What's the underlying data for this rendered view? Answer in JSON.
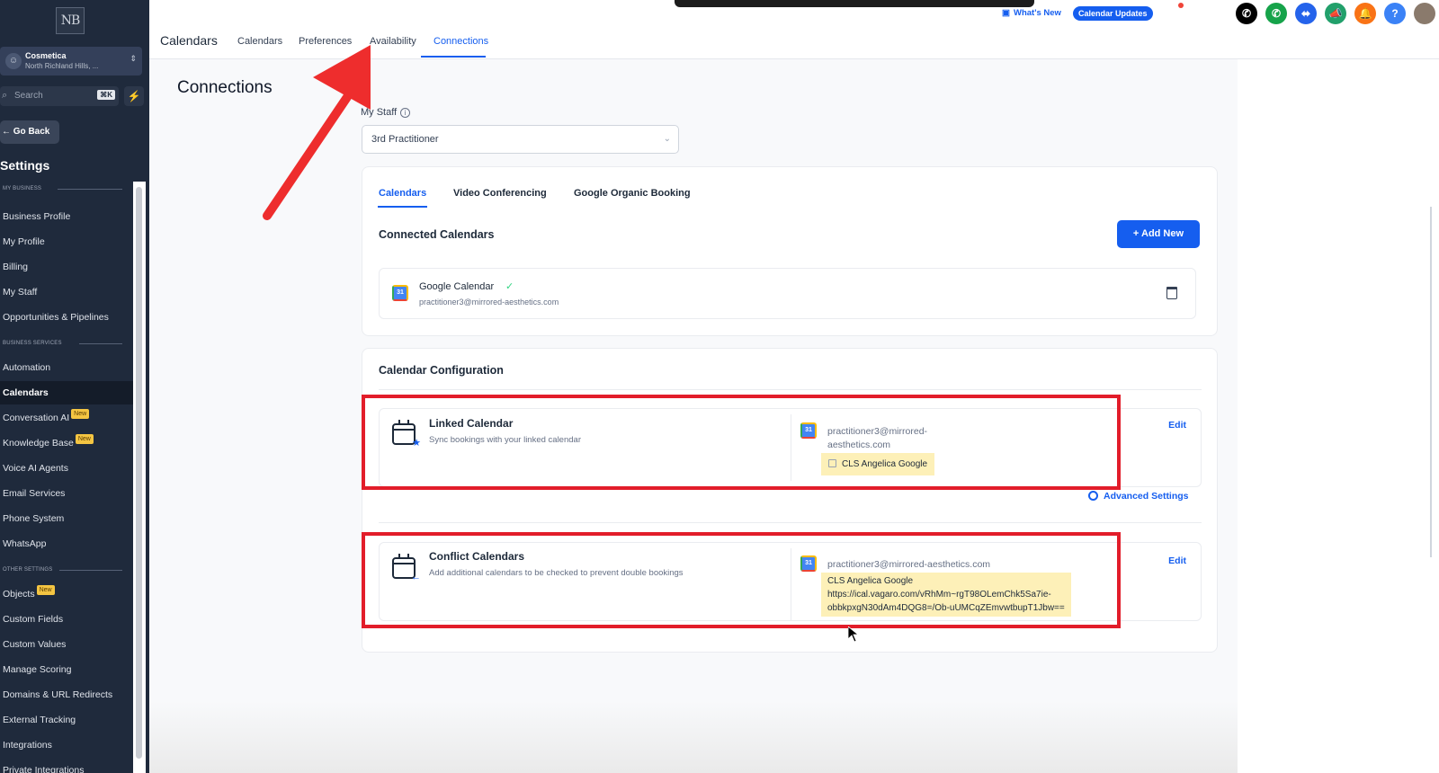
{
  "sidebar": {
    "logo": "NB",
    "account": {
      "name": "Cosmetica",
      "location": "North Richland Hills, ...",
      "avatar_glyph": "☺"
    },
    "search": {
      "placeholder": "Search",
      "shortcut": "⌘K"
    },
    "go_back": "← Go Back",
    "settings_title": "Settings",
    "sections": [
      {
        "label": "MY BUSINESS"
      },
      {
        "label": "BUSINESS SERVICES"
      },
      {
        "label": "OTHER SETTINGS"
      }
    ],
    "items": [
      {
        "label": "Business Profile"
      },
      {
        "label": "My Profile"
      },
      {
        "label": "Billing"
      },
      {
        "label": "My Staff"
      },
      {
        "label": "Opportunities & Pipelines"
      },
      {
        "label": "Automation"
      },
      {
        "label": "Calendars",
        "active": true
      },
      {
        "label": "Conversation AI",
        "badge": "New"
      },
      {
        "label": "Knowledge Base",
        "badge": "New"
      },
      {
        "label": "Voice AI Agents"
      },
      {
        "label": "Email Services"
      },
      {
        "label": "Phone System"
      },
      {
        "label": "WhatsApp"
      },
      {
        "label": "Objects",
        "badge": "New"
      },
      {
        "label": "Custom Fields"
      },
      {
        "label": "Custom Values"
      },
      {
        "label": "Manage Scoring"
      },
      {
        "label": "Domains & URL Redirects"
      },
      {
        "label": "External Tracking"
      },
      {
        "label": "Integrations"
      },
      {
        "label": "Private Integrations"
      }
    ]
  },
  "topbar": {
    "title": "Calendars",
    "tabs": [
      {
        "label": "Calendars"
      },
      {
        "label": "Preferences"
      },
      {
        "label": "Availability"
      },
      {
        "label": "Connections",
        "active": true
      }
    ],
    "whats_new": "What's New",
    "calendar_updates": "Calendar Updates",
    "icons": [
      {
        "name": "phone-icon",
        "color": "#000000"
      },
      {
        "name": "call-icon",
        "color": "#16a34a"
      },
      {
        "name": "apps-icon",
        "color": "#2563eb"
      },
      {
        "name": "megaphone-icon",
        "color": "#22a06b"
      },
      {
        "name": "bell-icon",
        "color": "#f97316"
      },
      {
        "name": "help-icon",
        "color": "#3b82f6"
      }
    ]
  },
  "main": {
    "page_title": "Connections",
    "staff_label": "My Staff",
    "staff_value": "3rd Practitioner",
    "subtabs": [
      {
        "label": "Calendars",
        "active": true
      },
      {
        "label": "Video Conferencing"
      },
      {
        "label": "Google Organic Booking"
      }
    ],
    "connected_title": "Connected Calendars",
    "add_new": "+ Add New",
    "connected": {
      "name": "Google Calendar",
      "check": "✓",
      "email": "practitioner3@mirrored-aesthetics.com"
    },
    "config_title": "Calendar Configuration",
    "linked": {
      "title": "Linked Calendar",
      "desc": "Sync bookings with your linked calendar",
      "email_line1": "practitioner3@mirrored-",
      "email_line2": "aesthetics.com",
      "chip": "CLS Angelica Google",
      "edit": "Edit"
    },
    "advanced": "Advanced Settings",
    "conflict": {
      "title": "Conflict Calendars",
      "desc": "Add additional calendars to be checked to prevent double bookings",
      "email": "practitioner3@mirrored-aesthetics.com",
      "chip_line1": "CLS Angelica Google",
      "chip_line2": "https://ical.vagaro.com/vRhMm~rgT98OLemChk5Sa7ie-",
      "chip_line3": "obbkpxgN30dAm4DQG8=/Ob-uUMCqZEmvwtbupT1Jbw==",
      "edit": "Edit"
    }
  },
  "colors": {
    "accent": "#155eef",
    "highlight": "#e21d2a",
    "chip": "#fdf0b8"
  }
}
